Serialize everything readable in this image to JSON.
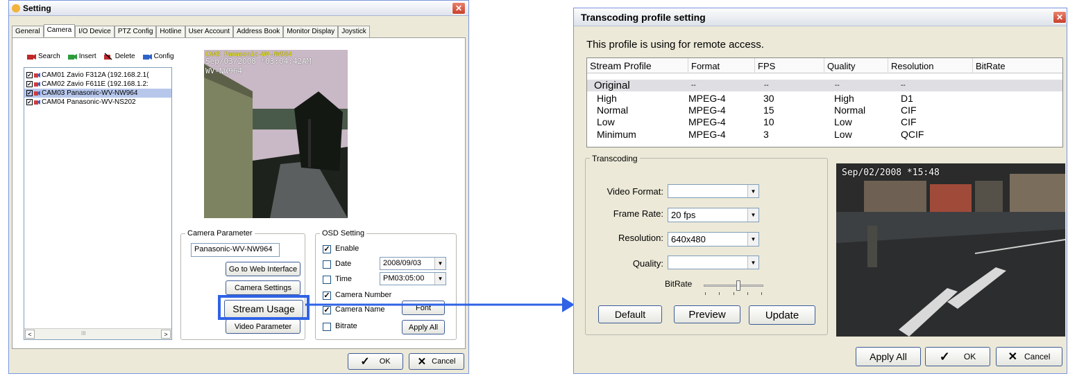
{
  "setting": {
    "title": "Setting",
    "tabs": [
      "General",
      "Camera",
      "I/O Device",
      "PTZ Config",
      "Hotline",
      "User Account",
      "Address Book",
      "Monitor Display",
      "Joystick"
    ],
    "toolbar": {
      "search": "Search",
      "insert": "Insert",
      "delete": "Delete",
      "config": "Config"
    },
    "cameras": [
      "CAM01 Zavio F312A (192.168.2.1(",
      "CAM02 Zavio F611E (192.168.1.2:",
      "CAM03 Panasonic-WV-NW964",
      "CAM04 Panasonic-WV-NS202"
    ],
    "preview": {
      "overlay_line1": "CAM3 Panasonic-WV-NW964",
      "overlay_line2": "Sep/03/2008 *03:04:42AM",
      "overlay_line3": "WV-NW964"
    },
    "camera_parameter": {
      "legend": "Camera Parameter",
      "model": "Panasonic-WV-NW964",
      "web_button": "Go to Web Interface",
      "settings_button": "Camera Settings",
      "stream_button": "Stream Usage",
      "video_button": "Video Parameter"
    },
    "osd": {
      "legend": "OSD Setting",
      "enable": "Enable",
      "date": "Date",
      "date_value": "2008/09/03",
      "time": "Time",
      "time_value": "PM03:05:00",
      "camera_number": "Camera Number",
      "camera_name": "Camera Name",
      "bitrate": "Bitrate",
      "font_button": "Font",
      "apply_all": "Apply All"
    },
    "ok": "OK",
    "cancel": "Cancel",
    "scroll_mid": "III"
  },
  "transcoding": {
    "title": "Transcoding profile setting",
    "description": "This profile is using for remote access.",
    "columns": [
      "Stream Profile",
      "Format",
      "FPS",
      "Quality",
      "Resolution",
      "BitRate"
    ],
    "rows": [
      [
        "Original",
        "--",
        "--",
        "--",
        "--"
      ],
      [
        "High",
        "MPEG-4",
        "30",
        "High",
        "D1"
      ],
      [
        "Normal",
        "MPEG-4",
        "15",
        "Normal",
        "CIF"
      ],
      [
        "Low",
        "MPEG-4",
        "10",
        "Low",
        "CIF"
      ],
      [
        "Minimum",
        "MPEG-4",
        "3",
        "Low",
        "QCIF"
      ]
    ],
    "group": "Transcoding",
    "video_format_label": "Video Format:",
    "video_format_value": "",
    "frame_rate_label": "Frame Rate:",
    "frame_rate_value": "20 fps",
    "resolution_label": "Resolution:",
    "resolution_value": "640x480",
    "quality_label": "Quality:",
    "quality_value": "",
    "bitrate_label": "BitRate",
    "bitrate_level": 0.6,
    "default_button": "Default",
    "preview_button": "Preview",
    "update_button": "Update",
    "preview_overlay": "Sep/02/2008 *15:48",
    "apply_all": "Apply All",
    "ok": "OK",
    "cancel": "Cancel"
  },
  "colors": {
    "highlight": "#2f62e6",
    "arrow": "#2f62e6",
    "xp_border": "#3c5a96"
  }
}
